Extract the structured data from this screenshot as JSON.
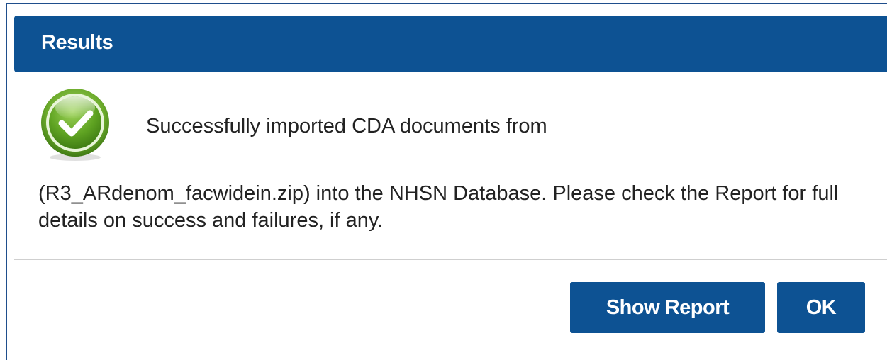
{
  "dialog": {
    "title": "Results",
    "message_line1": "Successfully imported CDA documents from",
    "message_rest": "(R3_ARdenom_facwidein.zip) into the NHSN Database. Please check the Report for full details on success and failures, if any.",
    "icon": "success-check-icon"
  },
  "buttons": {
    "show_report_label": "Show Report",
    "ok_label": "OK"
  },
  "colors": {
    "header": "#0d5293",
    "button": "#0d5293",
    "icon_green": "#6cab2b",
    "text": "#222222"
  }
}
